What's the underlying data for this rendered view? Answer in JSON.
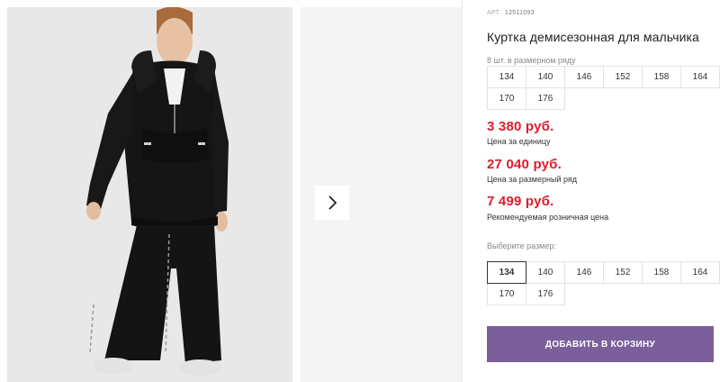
{
  "product": {
    "sku_prefix": "АРТ.",
    "sku": "12511093",
    "title": "Куртка демисезонная для мальчика"
  },
  "pack": {
    "label": "8 шт. в размерном ряду",
    "sizes": [
      "134",
      "140",
      "146",
      "152",
      "158",
      "164",
      "170",
      "176"
    ]
  },
  "prices": [
    {
      "value": "3 380 руб.",
      "note": "Цена за единицу"
    },
    {
      "value": "27 040 руб.",
      "note": "Цена за размерный ряд"
    },
    {
      "value": "7 499 руб.",
      "note": "Рекомендуемая розничная цена"
    }
  ],
  "size_select": {
    "label": "Выберите размер:",
    "sizes": [
      "134",
      "140",
      "146",
      "152",
      "158",
      "164",
      "170",
      "176"
    ],
    "selected": "134"
  },
  "cart_button": {
    "label": "ДОБАВИТЬ В КОРЗИНУ"
  },
  "icons": {
    "next": "chevron-right-icon"
  },
  "colors": {
    "price": "#e11b2c",
    "button": "#7a5f9b",
    "jacket": "#151515"
  }
}
